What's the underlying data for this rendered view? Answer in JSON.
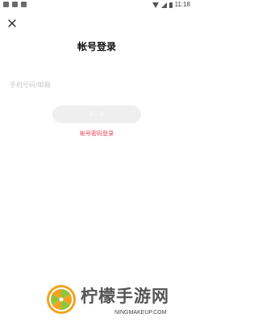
{
  "status_bar": {
    "time": "11:18",
    "left_icons": [
      "image-notification-icon",
      "notification-icon",
      "download-icon"
    ],
    "right_icons": [
      "wifi-icon",
      "signal-icon",
      "battery-icon"
    ]
  },
  "header": {
    "close_icon": "close-icon",
    "title": "帐号登录"
  },
  "form": {
    "account_placeholder": "手机号码/邮箱",
    "account_value": "",
    "next_button_label": "下一步",
    "password_login_link": "帐号密码登录"
  },
  "watermark": {
    "name": "柠檬手游网",
    "url": "NINGMAKEUP.COM"
  },
  "colors": {
    "accent_red": "#e8455a",
    "button_disabled": "#efefef",
    "placeholder": "#c9c9c9"
  }
}
